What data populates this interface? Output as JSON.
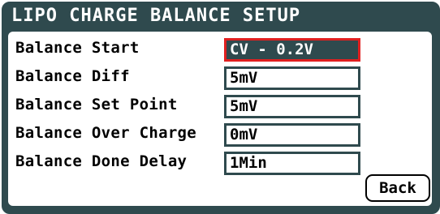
{
  "window": {
    "title": "LIPO CHARGE BALANCE SETUP"
  },
  "settings": [
    {
      "label": "Balance Start",
      "value": "CV - 0.2V",
      "selected": true
    },
    {
      "label": "Balance Diff",
      "value": "5mV",
      "selected": false
    },
    {
      "label": "Balance Set Point",
      "value": "5mV",
      "selected": false
    },
    {
      "label": "Balance Over Charge",
      "value": "0mV",
      "selected": false
    },
    {
      "label": "Balance Done Delay",
      "value": "1Min",
      "selected": false
    }
  ],
  "buttons": {
    "back_label": "Back"
  },
  "colors": {
    "panel_bg": "#2f4a4e",
    "selection_border": "#e02020",
    "text": "#000000"
  }
}
